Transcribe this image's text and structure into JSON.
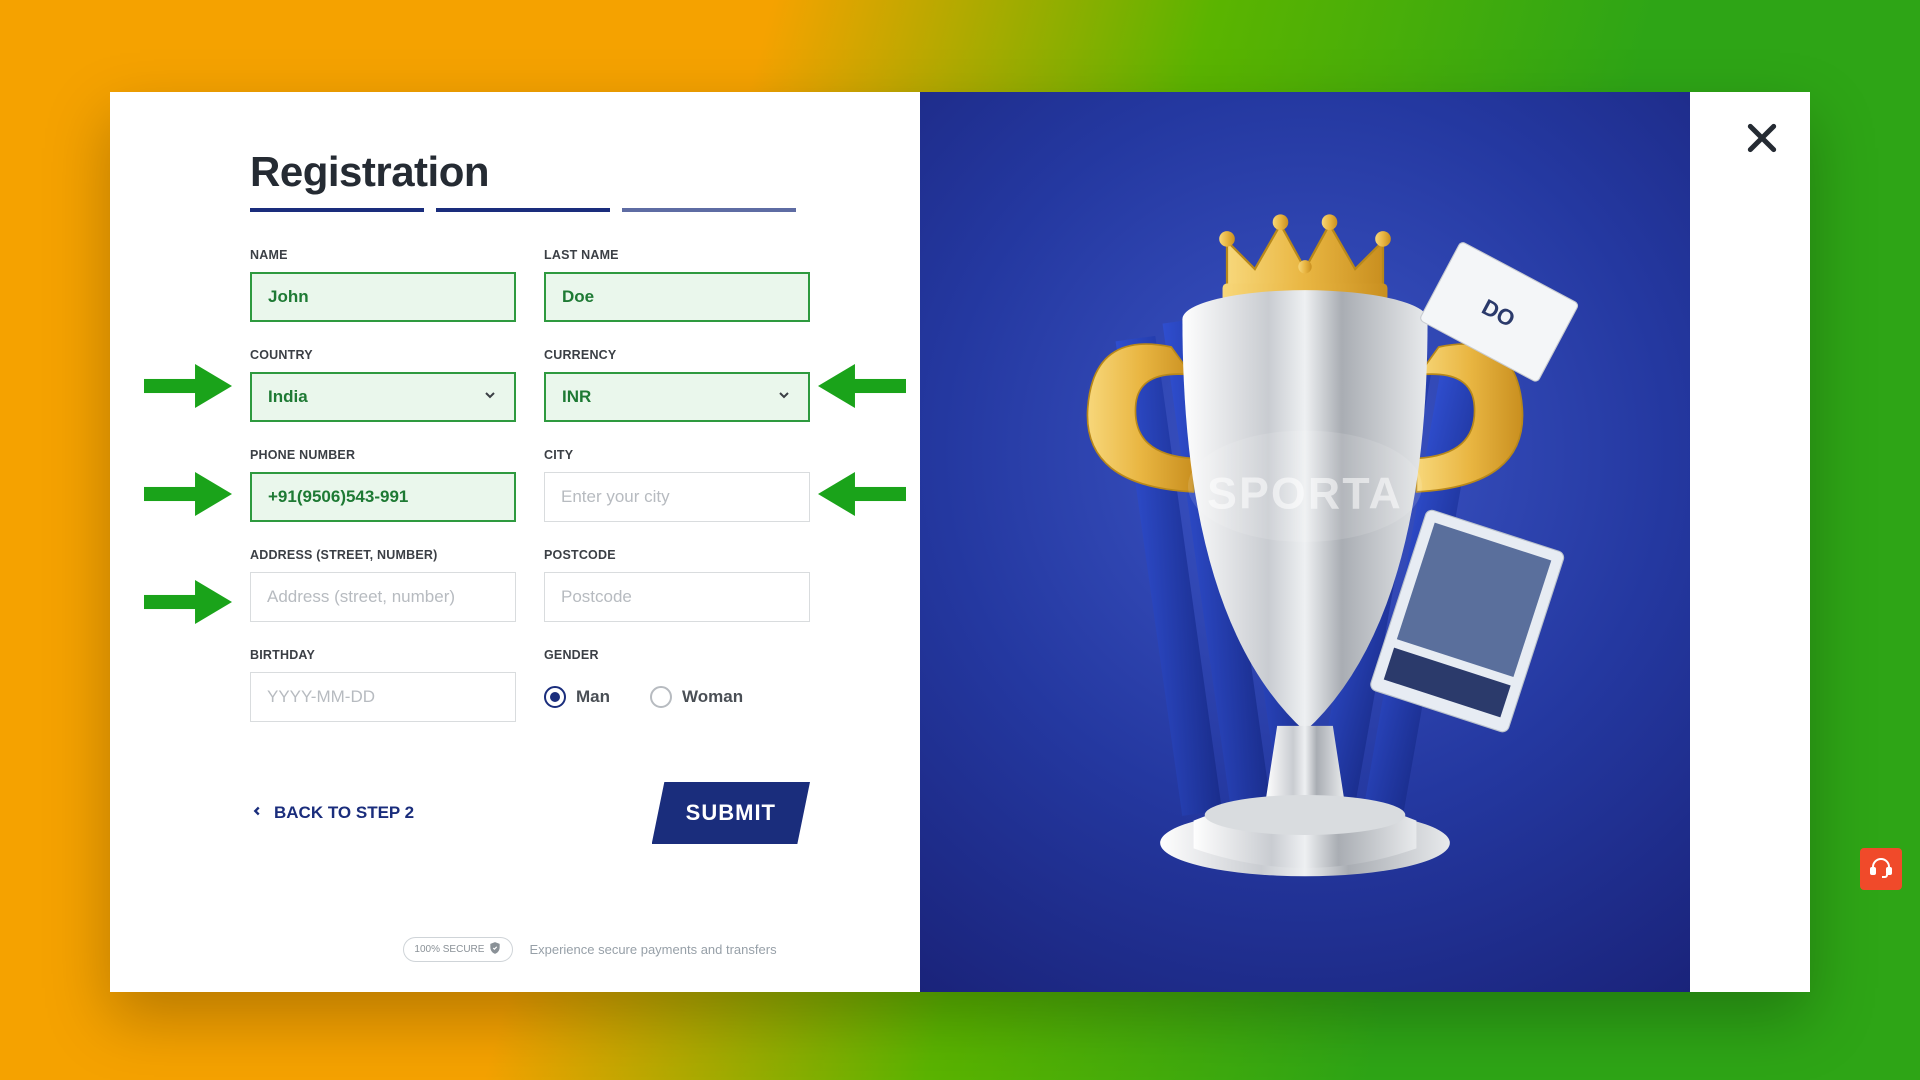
{
  "title": "Registration",
  "labels": {
    "name": "NAME",
    "last_name": "LAST NAME",
    "country": "COUNTRY",
    "currency": "CURRENCY",
    "phone": "PHONE NUMBER",
    "city": "CITY",
    "address": "ADDRESS (STREET, NUMBER)",
    "postcode": "POSTCODE",
    "birthday": "BIRTHDAY",
    "gender": "GENDER"
  },
  "values": {
    "name": "John",
    "last_name": "Doe",
    "country": "India",
    "currency": "INR",
    "phone": "+91(9506)543-991"
  },
  "placeholders": {
    "city": "Enter your city",
    "address": "Address (street, number)",
    "postcode": "Postcode",
    "birthday": "YYYY-MM-DD"
  },
  "gender": {
    "man": "Man",
    "woman": "Woman",
    "selected": "man"
  },
  "actions": {
    "back": "BACK TO STEP 2",
    "submit": "SUBMIT"
  },
  "footer": {
    "badge": "100% SECURE",
    "text": "Experience secure payments and transfers"
  },
  "colors": {
    "accent": "#1a2d7c",
    "success": "#2e9a3f",
    "arrow": "#1aa31a"
  }
}
